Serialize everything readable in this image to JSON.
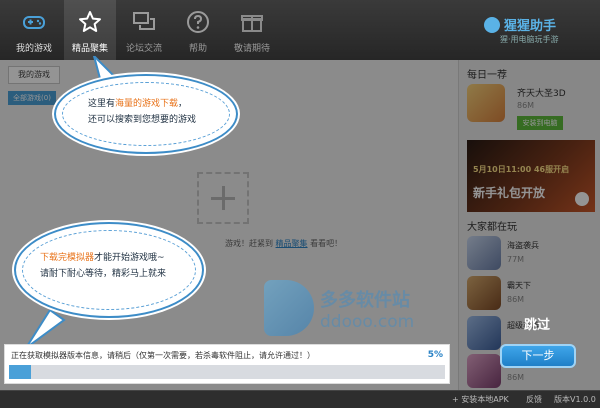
{
  "nav": {
    "items": [
      {
        "label": "我的游戏",
        "icon": "gamepad-icon"
      },
      {
        "label": "精品聚集",
        "icon": "star-icon"
      },
      {
        "label": "论坛交流",
        "icon": "chat-icon"
      },
      {
        "label": "帮助",
        "icon": "question-icon"
      },
      {
        "label": "敬请期待",
        "icon": "gift-icon"
      }
    ],
    "active_index": 1,
    "brand_name": "猩猩助手",
    "brand_slogan": "猩·用电脑玩手游"
  },
  "main": {
    "tab_label": "我的游戏",
    "filter_label": "全部游戏(0)",
    "empty_hint_pre": "游戏！赶紧到",
    "empty_hint_link": "精品聚集",
    "empty_hint_post": "看看吧！"
  },
  "side": {
    "daily_title": "每日一荐",
    "featured": {
      "name": "齐天大圣3D",
      "size": "86M",
      "install_label": "安装到电脑"
    },
    "banner_line1": "5月10日11:00 46服开启",
    "banner_line2": "新手礼包开放",
    "popular_title": "大家都在玩",
    "popular": [
      {
        "name": "海盗袭兵",
        "size": "77M"
      },
      {
        "name": "霸天下",
        "size": "86M"
      },
      {
        "name": "超级英雄",
        "size": ""
      },
      {
        "name": "",
        "size": "86M"
      }
    ]
  },
  "bubbles": {
    "top_pre": "这里有",
    "top_hl": "海量的游戏下载",
    "top_post": "，",
    "top_line2": "还可以搜索到您想要的游戏",
    "bottom_hl": "下载完模拟器",
    "bottom_post": "才能开始游戏哦~",
    "bottom_line2": "请耐下耐心等待，精彩马上就来"
  },
  "progress": {
    "message": "正在获取模拟器版本信息，请稍后（仅第一次需要，若杀毒软件阻止，请允许通过！）",
    "percent_text": "5%",
    "fraction": 0.05
  },
  "actions": {
    "skip_label": "跳过",
    "next_label": "下一步"
  },
  "watermark": {
    "cn": "多多软件站",
    "en": "ddooo.com"
  },
  "bottom": {
    "install_apk": "+ 安装本地APK",
    "feedback": "反馈",
    "version": "版本V1.0.0"
  },
  "colors": {
    "accent": "#3d8cc7",
    "highlight": "#e8731a",
    "install": "#5dbb3c"
  }
}
